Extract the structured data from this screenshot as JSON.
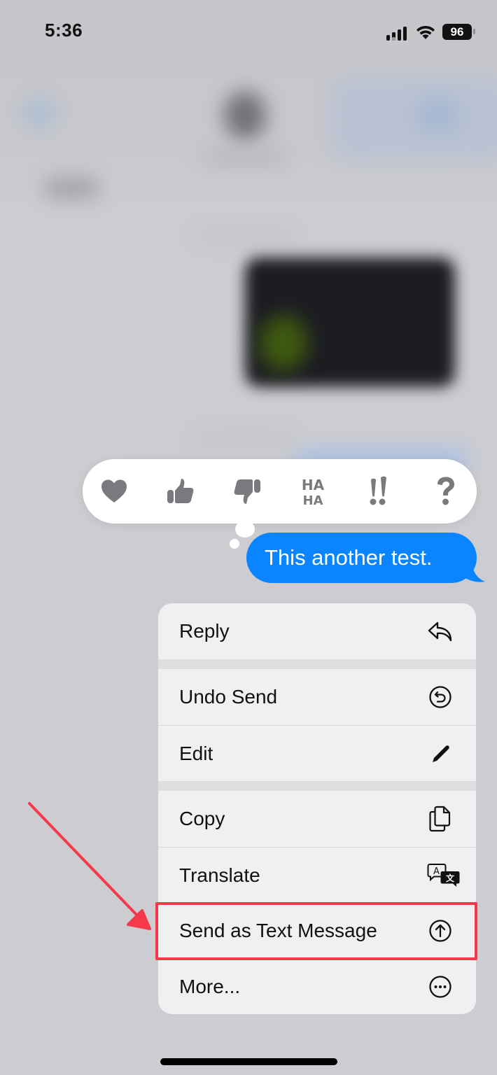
{
  "status_bar": {
    "time": "5:36",
    "battery": "96",
    "icons": [
      "signal-icon",
      "wifi-icon",
      "battery-icon"
    ]
  },
  "reactions": [
    {
      "name": "heart",
      "icon": "heart-icon"
    },
    {
      "name": "thumbs-up",
      "icon": "thumbs-up-icon"
    },
    {
      "name": "thumbs-down",
      "icon": "thumbs-down-icon"
    },
    {
      "name": "haha",
      "icon": "haha-icon",
      "text_top": "HA",
      "text_bottom": "HA"
    },
    {
      "name": "exclamation",
      "icon": "double-exclamation-icon",
      "text": "!!"
    },
    {
      "name": "question",
      "icon": "question-icon",
      "text": "?"
    }
  ],
  "message": {
    "text": "This another test.",
    "bubble_color": "#0a84ff"
  },
  "menu": {
    "items": [
      {
        "label": "Reply",
        "icon": "reply-arrow-icon"
      },
      {
        "label": "Undo Send",
        "icon": "undo-circle-icon"
      },
      {
        "label": "Edit",
        "icon": "pencil-icon"
      },
      {
        "label": "Copy",
        "icon": "copy-documents-icon"
      },
      {
        "label": "Translate",
        "icon": "translate-bubbles-icon"
      },
      {
        "label": "Send as Text Message",
        "icon": "arrow-up-circle-icon",
        "highlighted": true
      },
      {
        "label": "More...",
        "icon": "ellipsis-circle-icon"
      }
    ]
  },
  "annotation": {
    "color": "#f5384a",
    "target": "Send as Text Message"
  }
}
